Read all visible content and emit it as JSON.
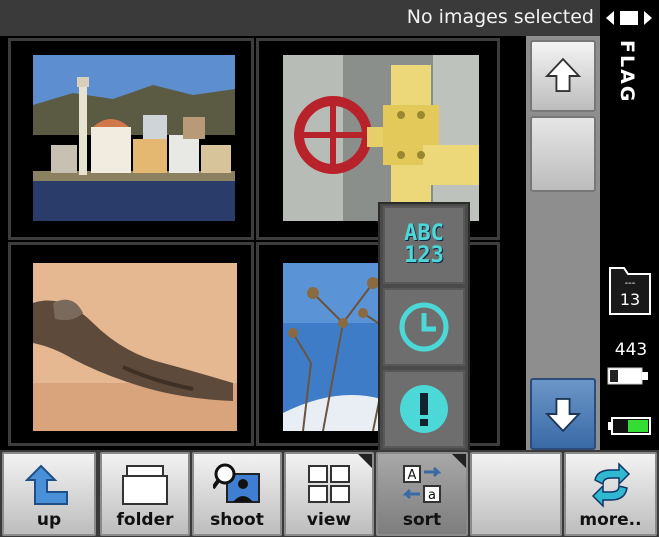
{
  "status": {
    "text": "No images selected"
  },
  "right_panel": {
    "vertical_label": "FLAG",
    "card_count": "13",
    "card_top": "---",
    "remaining": "443"
  },
  "sort_menu": {
    "options": [
      {
        "name": "alphabetical",
        "label": "ABC\n123"
      },
      {
        "name": "date",
        "icon": "clock-icon"
      },
      {
        "name": "flag",
        "icon": "exclamation-icon"
      }
    ]
  },
  "toolbar": {
    "buttons": [
      {
        "label": "up",
        "icon": "up-arrow-icon"
      },
      {
        "label": "folder",
        "icon": "folder-icon"
      },
      {
        "label": "shoot",
        "icon": "shoot-icon"
      },
      {
        "label": "view",
        "icon": "view-grid-icon"
      },
      {
        "label": "sort",
        "icon": "sort-icon"
      },
      {
        "label": "",
        "icon": ""
      },
      {
        "label": "more..",
        "icon": "refresh-arrows-icon"
      }
    ]
  },
  "colors": {
    "accent_cyan": "#4dd8d8",
    "selection_blue": "#3a6aa6",
    "battery_green": "#33dd33"
  }
}
